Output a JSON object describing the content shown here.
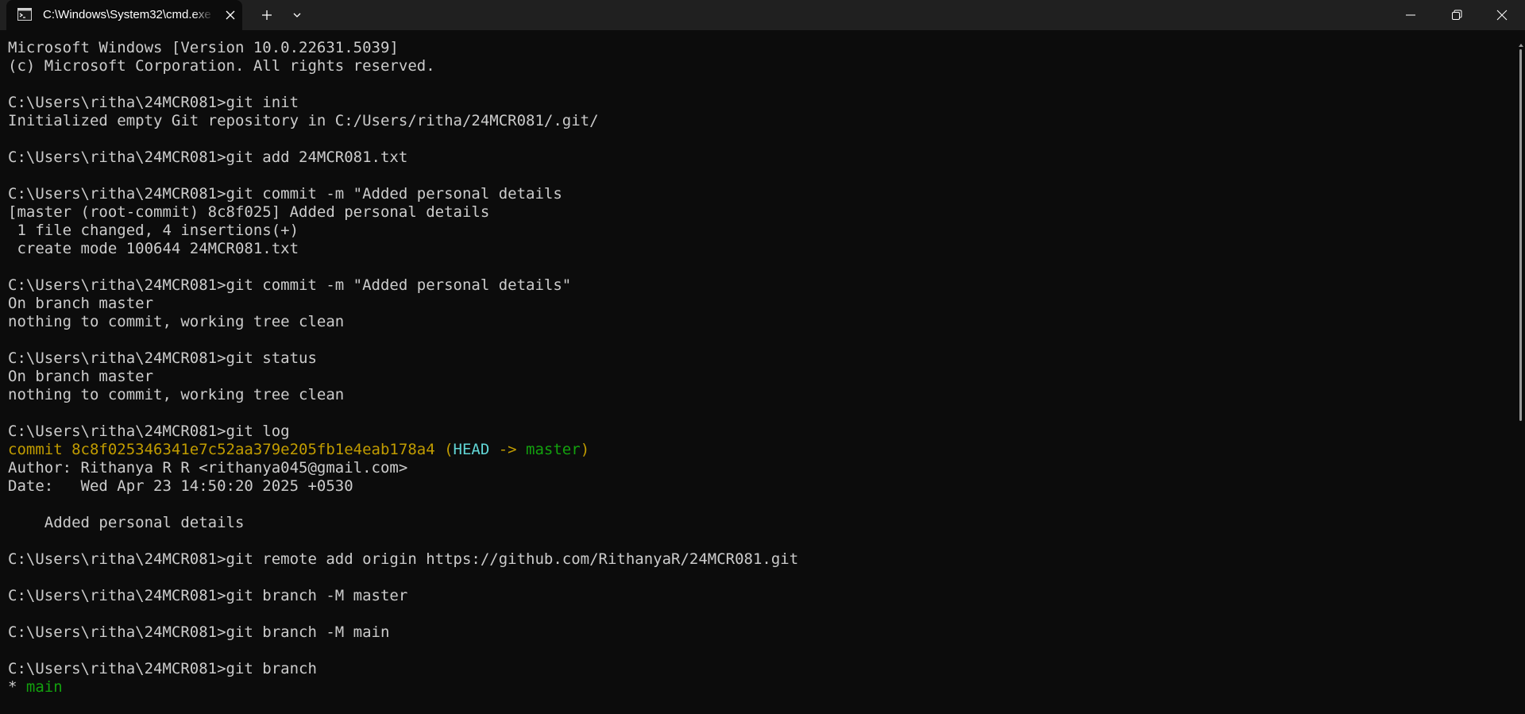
{
  "window": {
    "tab_title": "C:\\Windows\\System32\\cmd.exe",
    "icons": {
      "tab": "cmd-icon",
      "close_tab": "close-icon",
      "new_tab": "plus-icon",
      "dropdown": "chevron-down-icon",
      "minimize": "minimize-icon",
      "maximize": "restore-icon",
      "close_window": "close-icon"
    }
  },
  "terminal": {
    "colors": {
      "background": "#0c0c0c",
      "text": "#cccccc",
      "commit_hash": "#c19c00",
      "head_ref": "#61d6d6",
      "branch": "#13a10e"
    },
    "lines": [
      "Microsoft Windows [Version 10.0.22631.5039]",
      "(c) Microsoft Corporation. All rights reserved.",
      "",
      "C:\\Users\\ritha\\24MCR081>git init",
      "Initialized empty Git repository in C:/Users/ritha/24MCR081/.git/",
      "",
      "C:\\Users\\ritha\\24MCR081>git add 24MCR081.txt",
      "",
      "C:\\Users\\ritha\\24MCR081>git commit -m \"Added personal details",
      "[master (root-commit) 8c8f025] Added personal details",
      " 1 file changed, 4 insertions(+)",
      " create mode 100644 24MCR081.txt",
      "",
      "C:\\Users\\ritha\\24MCR081>git commit -m \"Added personal details\"",
      "On branch master",
      "nothing to commit, working tree clean",
      "",
      "C:\\Users\\ritha\\24MCR081>git status",
      "On branch master",
      "nothing to commit, working tree clean",
      "",
      "C:\\Users\\ritha\\24MCR081>git log",
      "__COMMIT__",
      "Author: Rithanya R R <rithanya045@gmail.com>",
      "Date:   Wed Apr 23 14:50:20 2025 +0530",
      "",
      "    Added personal details",
      "",
      "C:\\Users\\ritha\\24MCR081>git remote add origin https://github.com/RithanyaR/24MCR081.git",
      "",
      "C:\\Users\\ritha\\24MCR081>git branch -M master",
      "",
      "C:\\Users\\ritha\\24MCR081>git branch -M main",
      "",
      "C:\\Users\\ritha\\24MCR081>git branch",
      "__BRANCH__"
    ],
    "commit_line": {
      "prefix": "commit 8c8f025346341e7c52aa379e205fb1e4eab178a4 (",
      "head": "HEAD",
      "arrow": " -> ",
      "branch": "master",
      "suffix": ")"
    },
    "branch_line": {
      "marker": "* ",
      "name": "main"
    }
  }
}
